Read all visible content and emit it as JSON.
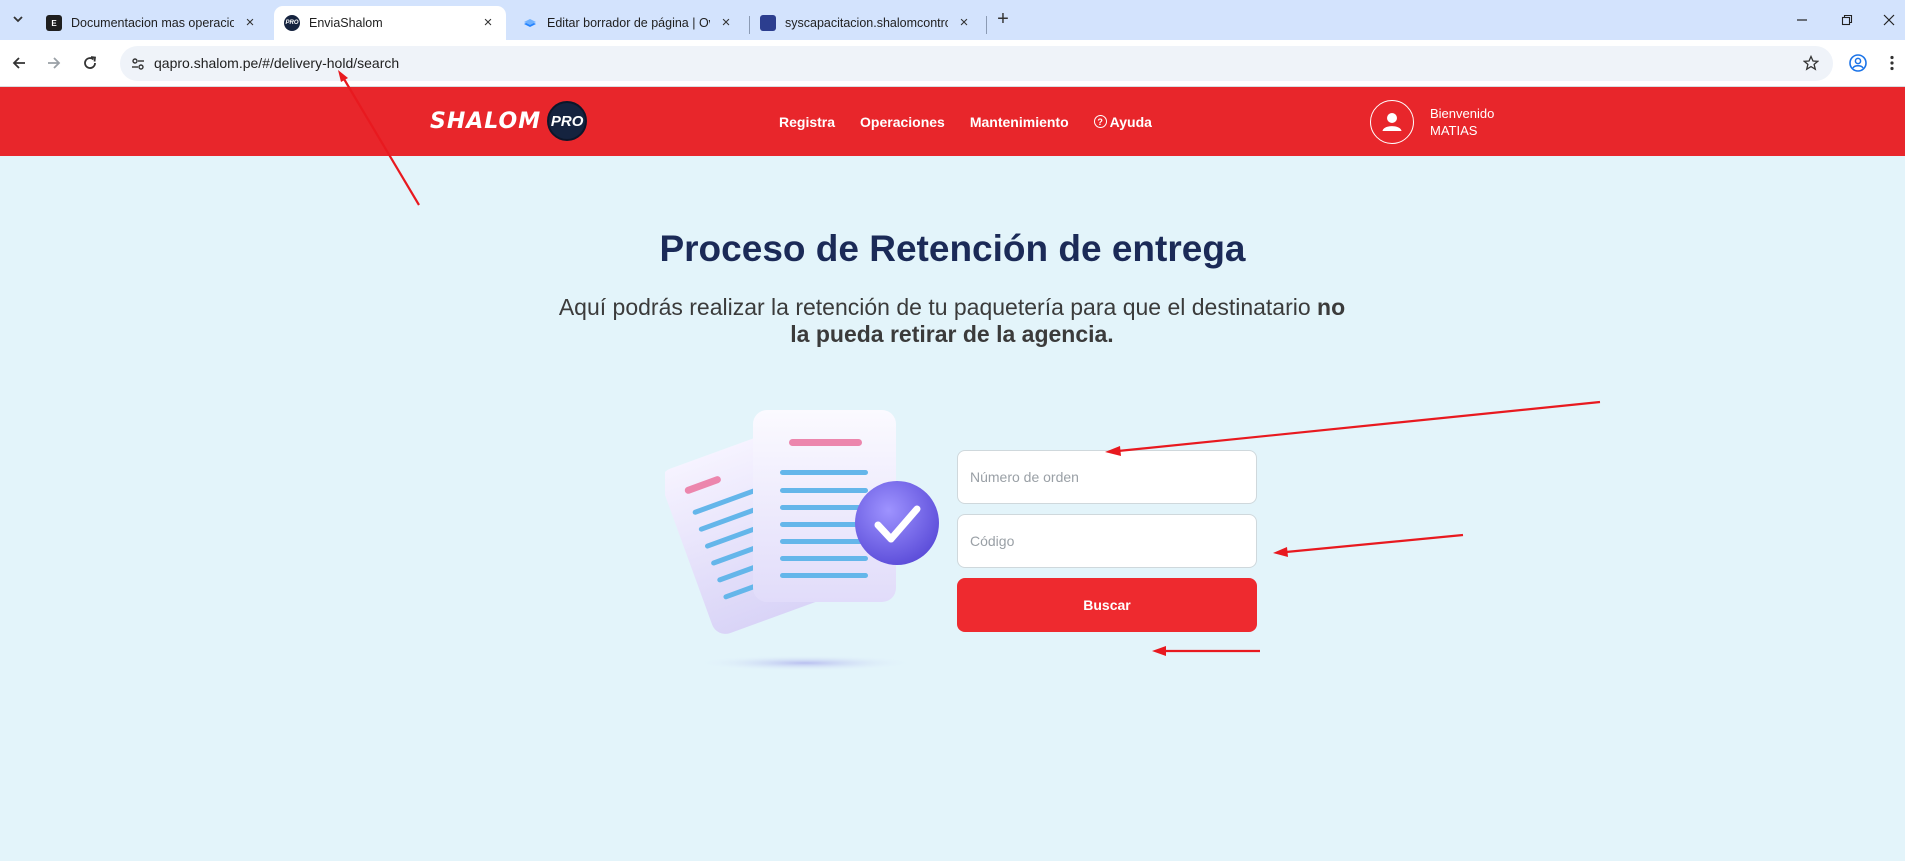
{
  "browser": {
    "tabs": [
      {
        "title": "Documentacion mas operacion",
        "favicon": "E",
        "active": false
      },
      {
        "title": "EnviaShalom",
        "favicon": "PRO",
        "active": true
      },
      {
        "title": "Editar borrador de página | Ove",
        "favicon": "",
        "active": false
      },
      {
        "title": "syscapacitacion.shalomcontrol.c",
        "favicon": "",
        "active": false
      }
    ],
    "url": "qapro.shalom.pe/#/delivery-hold/search"
  },
  "header": {
    "logo_text": "SHALOM",
    "logo_badge": "PRO",
    "nav": [
      "Registra",
      "Operaciones",
      "Mantenimiento",
      "Ayuda"
    ],
    "welcome": "Bienvenido",
    "user_name": "MATIAS"
  },
  "main": {
    "title_prefix": "Proceso de ",
    "title_bold": "Retención de entrega",
    "subtitle_part1": "Aquí podrás realizar la retención de tu paquetería para que el destinatario ",
    "subtitle_bold": "no la pueda retirar de la agencia."
  },
  "form": {
    "order_placeholder": "Número de orden",
    "code_placeholder": "Código",
    "submit_label": "Buscar"
  },
  "colors": {
    "header_red": "#e8262b",
    "button_red": "#ee2a2f",
    "page_bg": "#e3f4fa",
    "title_navy": "#1b2a57",
    "annotation_red": "#e8191f"
  }
}
